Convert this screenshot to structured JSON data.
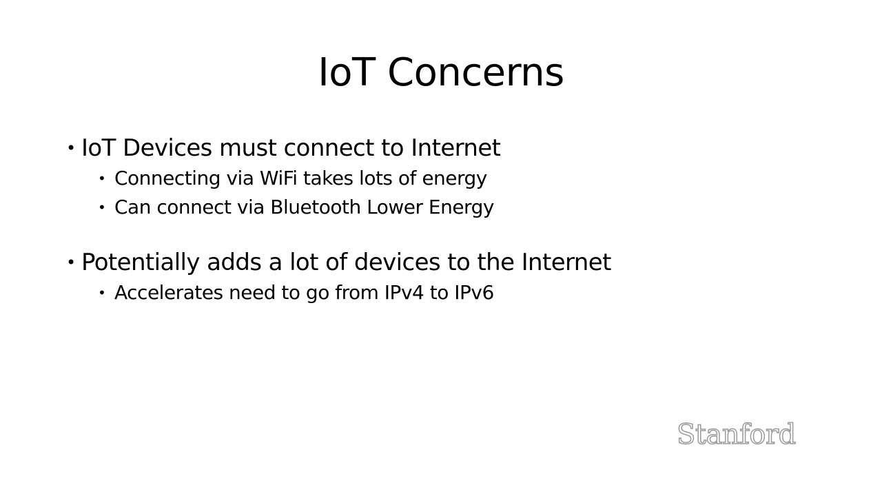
{
  "slide": {
    "title": "IoT Concerns",
    "bullets": [
      {
        "text": "IoT Devices must connect to Internet",
        "sub": [
          "Connecting via WiFi takes lots of energy",
          "Can connect via Bluetooth Lower Energy"
        ]
      },
      {
        "text": "Potentially adds a lot of devices to the Internet",
        "sub": [
          "Accelerates need to go from IPv4 to IPv6"
        ]
      }
    ],
    "logo_text": "Stanford",
    "bullet_glyph": "•"
  },
  "colors": {
    "background": "#ffffff",
    "text": "#000000",
    "logo_outline": "#9a9a9a"
  }
}
